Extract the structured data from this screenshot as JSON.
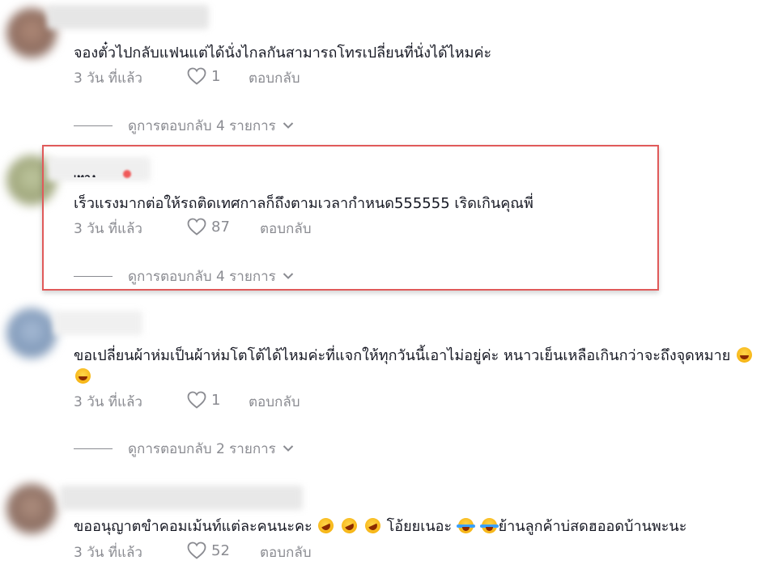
{
  "comments": [
    {
      "text": "จองตั๋วไปกลับแฟนแต่ได้นั่งไกลกันสามารถโทรเปลี่ยนที่นั่งได้ไหมค่ะ",
      "time": "3 วัน ที่แล้ว",
      "likes": "1",
      "reply_label": "ตอบกลับ",
      "view_replies": "ดูการตอบกลับ 4 รายการ"
    },
    {
      "username_partial": "เทอง",
      "text": "เร็วแรงมากต่อให้รถติดเทศกาลก็ถึงตามเวลากำหนด555555 เริดเกินคุณพี่",
      "time": "3 วัน ที่แล้ว",
      "likes": "87",
      "reply_label": "ตอบกลับ",
      "view_replies": "ดูการตอบกลับ 4 รายการ"
    },
    {
      "text": "ขอเปลี่ยนผ้าห่มเป็นผ้าห่มโตโต้ได้ไหมค่ะที่แจกให้ทุกวันนี้เอาไม่อยู่ค่ะ หนาวเย็นเหลือเกินกว่าจะถึงจุดหมาย",
      "time": "3 วัน ที่แล้ว",
      "likes": "1",
      "reply_label": "ตอบกลับ",
      "view_replies": "ดูการตอบกลับ 2 รายการ"
    },
    {
      "text_part1": "ขออนุญาตขำคอมเม้นท์แต่ละคนนะคะ",
      "text_part2": "โอ้ยยเนอะ",
      "text_part3": "ย้านลูกค้าบ่สดฮออดบ้านพะนะ",
      "time": "3 วัน ที่แล้ว",
      "likes": "52",
      "reply_label": "ตอบกลับ"
    }
  ],
  "icons": {
    "like": "heart-outline-icon",
    "expand": "chevron-down-icon",
    "emoji_grin": "grinning-squinting-face-emoji",
    "emoji_rofl": "rolling-on-floor-laughing-emoji",
    "emoji_joy": "face-with-tears-of-joy-emoji"
  },
  "colors": {
    "text": "#161823",
    "meta": "#8a8b91",
    "highlight_border": "#e05a5a"
  }
}
